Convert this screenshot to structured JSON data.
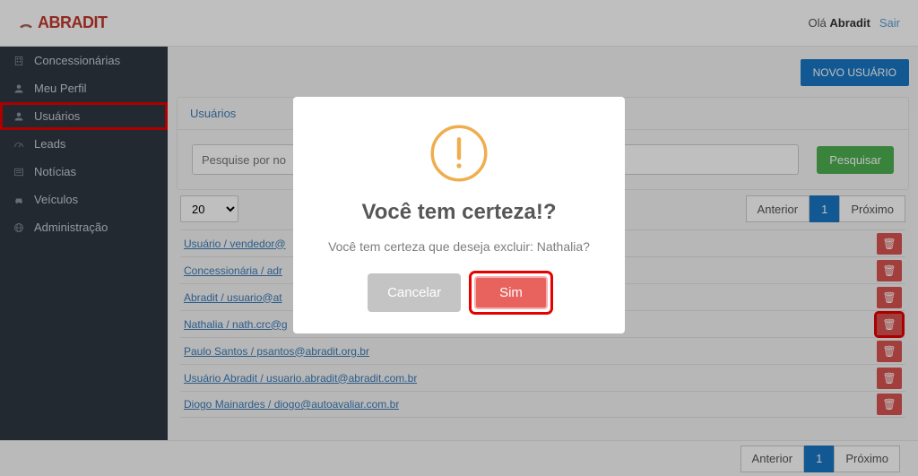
{
  "header": {
    "brand": "ABRADIT",
    "greeting_prefix": "Olá ",
    "greeting_name": "Abradit",
    "logout": "Sair"
  },
  "sidebar": {
    "items": [
      {
        "label": "Concessionárias",
        "icon": "building-icon"
      },
      {
        "label": "Meu Perfil",
        "icon": "user-icon"
      },
      {
        "label": "Usuários",
        "icon": "user-icon",
        "highlighted": true
      },
      {
        "label": "Leads",
        "icon": "gauge-icon"
      },
      {
        "label": "Notícias",
        "icon": "newspaper-icon"
      },
      {
        "label": "Veículos",
        "icon": "car-icon"
      },
      {
        "label": "Administração",
        "icon": "globe-icon"
      }
    ]
  },
  "main": {
    "new_user_button": "NOVO USUÁRIO",
    "panel_title": "Usuários",
    "search": {
      "placeholder": "Pesquise por no",
      "button": "Pesquisar"
    },
    "page_size": "20",
    "pager": {
      "prev": "Anterior",
      "current": "1",
      "next": "Próximo"
    },
    "rows": [
      {
        "label": "Usuário / vendedor@"
      },
      {
        "label": "Concessionária / adr"
      },
      {
        "label": "Abradit / usuario@at"
      },
      {
        "label": "Nathalia / nath.crc@g",
        "delete_highlighted": true
      },
      {
        "label": "Paulo Santos / psantos@abradit.org.br"
      },
      {
        "label": "Usuário Abradit / usuario.abradit@abradit.com.br"
      },
      {
        "label": "Diogo Mainardes / diogo@autoavaliar.com.br"
      }
    ]
  },
  "modal": {
    "title": "Você tem certeza!?",
    "text": "Você tem certeza que deseja excluir: Nathalia?",
    "cancel": "Cancelar",
    "confirm": "Sim"
  }
}
